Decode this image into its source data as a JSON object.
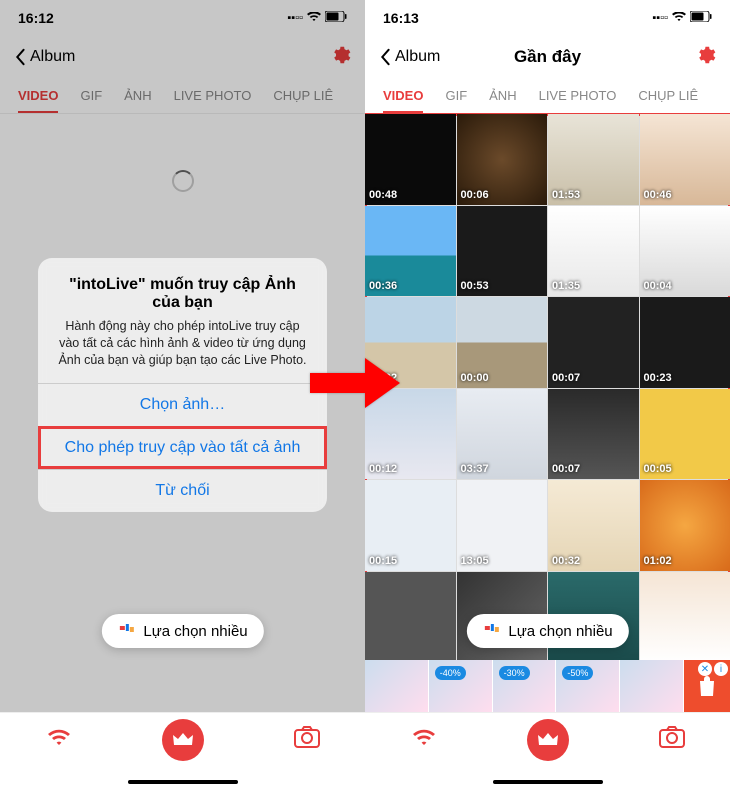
{
  "left": {
    "status_time": "16:12",
    "back_label": "Album",
    "tabs": [
      "VIDEO",
      "GIF",
      "ẢNH",
      "LIVE PHOTO",
      "CHỤP LIÊ"
    ],
    "alert": {
      "title": "\"intoLive\" muốn truy cập Ảnh của bạn",
      "message": "Hành động này cho phép intoLive truy cập vào tất cả các hình ảnh & video từ ứng dụng Ảnh của bạn và giúp bạn tạo các Live Photo.",
      "select": "Chọn ảnh…",
      "allow": "Cho phép truy cập vào tất cả ảnh",
      "deny": "Từ chối"
    },
    "multi": "Lựa chọn nhiều"
  },
  "right": {
    "status_time": "16:13",
    "back_label": "Album",
    "title": "Gần đây",
    "tabs": [
      "VIDEO",
      "GIF",
      "ẢNH",
      "LIVE PHOTO",
      "CHỤP LIÊ"
    ],
    "durations": [
      "00:48",
      "00:06",
      "01:53",
      "00:46",
      "00:36",
      "00:53",
      "01:35",
      "00:04",
      "00:02",
      "00:00",
      "00:07",
      "00:23",
      "00:12",
      "03:37",
      "00:07",
      "00:05",
      "00:15",
      "13:05",
      "00:32",
      "01:02",
      "",
      "",
      "",
      ""
    ],
    "multi": "Lựa chọn nhiều",
    "ad_badges": [
      "-40%",
      "-30%",
      "-50%"
    ]
  }
}
